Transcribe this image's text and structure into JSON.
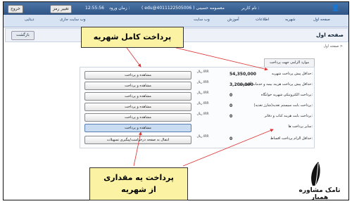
{
  "topbar": {
    "exit_label": "خروج",
    "change_pass_label": "تغییر رمز",
    "time": "12:55:56",
    "time_label": "زمان ورود :",
    "user": "( edu@4011122505006 ) معصومه حسینی",
    "user_prefix": "نام کاربر :"
  },
  "nav": {
    "items": [
      "صفحه اول",
      "شهریه",
      "اطلاعات",
      "آموزش",
      "وب سایت",
      "وب سایت جاری",
      "دیتایی"
    ]
  },
  "page": {
    "title": "صفحه اول",
    "back_label": "بازگشت",
    "breadcrumb": "صفحه اول >",
    "section_head": "موارد الزامی جهت پرداخت"
  },
  "rows": [
    {
      "label": "حداقل پیش پرداخت شهریه:",
      "currency": "ریال IRR",
      "amount": "54,350,000",
      "button": "مشاهده و پرداخت"
    },
    {
      "label": "حداقل پیش پرداخت هزینه بیمه و خدمات آموزشی:",
      "currency": "ریال IRR",
      "amount": "3,200,000",
      "button": "مشاهده و پرداخت"
    },
    {
      "label": "پرداخت الکترونیکی شهریه خوابگاه:",
      "currency": "ریال IRR",
      "amount": "0",
      "button": "مشاهده و پرداخت"
    },
    {
      "label": "پرداخت بابت سیستم تغذیه(شارژ تغذیه):",
      "currency": "ریال IRR",
      "amount": "0",
      "button": "مشاهده و پرداخت"
    },
    {
      "label": "پرداخت بابت هزینه کتاب و دفاتر:",
      "currency": "ریال IRR",
      "amount": "0",
      "button": "مشاهده و پرداخت"
    },
    {
      "label": "سایر پرداخت ها:",
      "currency": "",
      "amount": "",
      "button": "مشاهده و پرداخت"
    },
    {
      "label": "حداقل الزام پرداخت اقساط:",
      "currency": "ریال IRR",
      "amount": "0",
      "button": "انتقال به صفحه درخواست/پیگیری تسهیلات"
    }
  ],
  "callouts": {
    "full_payment": "پرداخت کامل شهریه",
    "partial_line1": "پرداخت یه مقداری",
    "partial_line2": "از شهریه"
  },
  "watermark": {
    "text": "تامک مشاوره همیار"
  }
}
